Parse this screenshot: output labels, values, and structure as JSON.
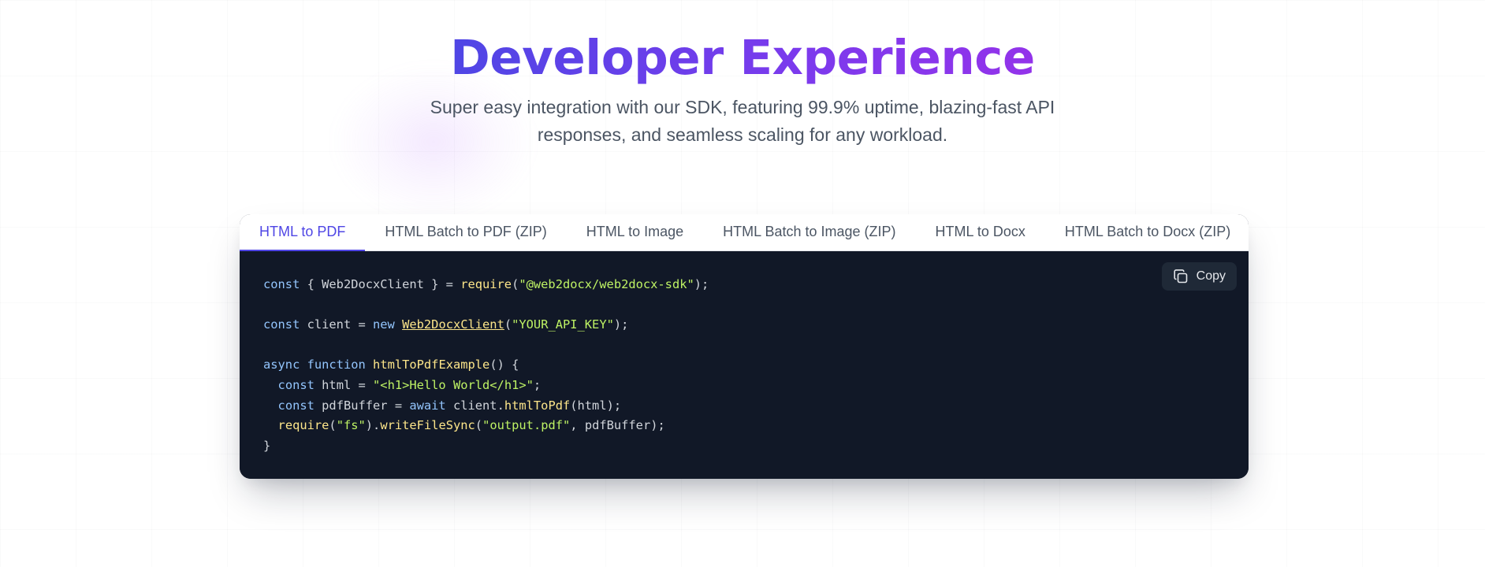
{
  "hero": {
    "title": "Developer Experience",
    "subtitle": "Super easy integration with our SDK, featuring 99.9% uptime, blazing-fast API responses, and seamless scaling for any workload."
  },
  "tabs": [
    {
      "label": "HTML to PDF",
      "active": true
    },
    {
      "label": "HTML Batch to PDF (ZIP)",
      "active": false
    },
    {
      "label": "HTML to Image",
      "active": false
    },
    {
      "label": "HTML Batch to Image (ZIP)",
      "active": false
    },
    {
      "label": "HTML to Docx",
      "active": false
    },
    {
      "label": "HTML Batch to Docx (ZIP)",
      "active": false
    }
  ],
  "copy_button": {
    "label": "Copy",
    "icon": "copy-icon"
  },
  "code": {
    "language": "javascript",
    "lines": [
      [
        {
          "t": "kw",
          "v": "const"
        },
        {
          "t": "pl",
          "v": " { Web2DocxClient } = "
        },
        {
          "t": "fn",
          "v": "require"
        },
        {
          "t": "pl",
          "v": "("
        },
        {
          "t": "str",
          "v": "\"@web2docx/web2docx-sdk\""
        },
        {
          "t": "pl",
          "v": ");"
        }
      ],
      [],
      [
        {
          "t": "kw",
          "v": "const"
        },
        {
          "t": "pl",
          "v": " client = "
        },
        {
          "t": "kw",
          "v": "new"
        },
        {
          "t": "pl",
          "v": " "
        },
        {
          "t": "cls",
          "v": "Web2DocxClient"
        },
        {
          "t": "pl",
          "v": "("
        },
        {
          "t": "str",
          "v": "\"YOUR_API_KEY\""
        },
        {
          "t": "pl",
          "v": ");"
        }
      ],
      [],
      [
        {
          "t": "kw",
          "v": "async"
        },
        {
          "t": "pl",
          "v": " "
        },
        {
          "t": "kw",
          "v": "function"
        },
        {
          "t": "pl",
          "v": " "
        },
        {
          "t": "fn",
          "v": "htmlToPdfExample"
        },
        {
          "t": "pl",
          "v": "() {"
        }
      ],
      [
        {
          "t": "pl",
          "v": "  "
        },
        {
          "t": "kw",
          "v": "const"
        },
        {
          "t": "pl",
          "v": " html = "
        },
        {
          "t": "str",
          "v": "\"<h1>Hello World</h1>\""
        },
        {
          "t": "pl",
          "v": ";"
        }
      ],
      [
        {
          "t": "pl",
          "v": "  "
        },
        {
          "t": "kw",
          "v": "const"
        },
        {
          "t": "pl",
          "v": " pdfBuffer = "
        },
        {
          "t": "kw",
          "v": "await"
        },
        {
          "t": "pl",
          "v": " client."
        },
        {
          "t": "fn",
          "v": "htmlToPdf"
        },
        {
          "t": "pl",
          "v": "(html);"
        }
      ],
      [
        {
          "t": "pl",
          "v": "  "
        },
        {
          "t": "fn",
          "v": "require"
        },
        {
          "t": "pl",
          "v": "("
        },
        {
          "t": "str",
          "v": "\"fs\""
        },
        {
          "t": "pl",
          "v": ")."
        },
        {
          "t": "fn",
          "v": "writeFileSync"
        },
        {
          "t": "pl",
          "v": "("
        },
        {
          "t": "str",
          "v": "\"output.pdf\""
        },
        {
          "t": "pl",
          "v": ", pdfBuffer);"
        }
      ],
      [
        {
          "t": "pl",
          "v": "}"
        }
      ]
    ]
  },
  "colors": {
    "accent": "#4f46e5",
    "title_gradient_start": "#4f46e5",
    "title_gradient_end": "#9333ea",
    "code_background": "#111827",
    "keyword": "#93c5fd",
    "function": "#fde68a",
    "string": "#bef264"
  }
}
